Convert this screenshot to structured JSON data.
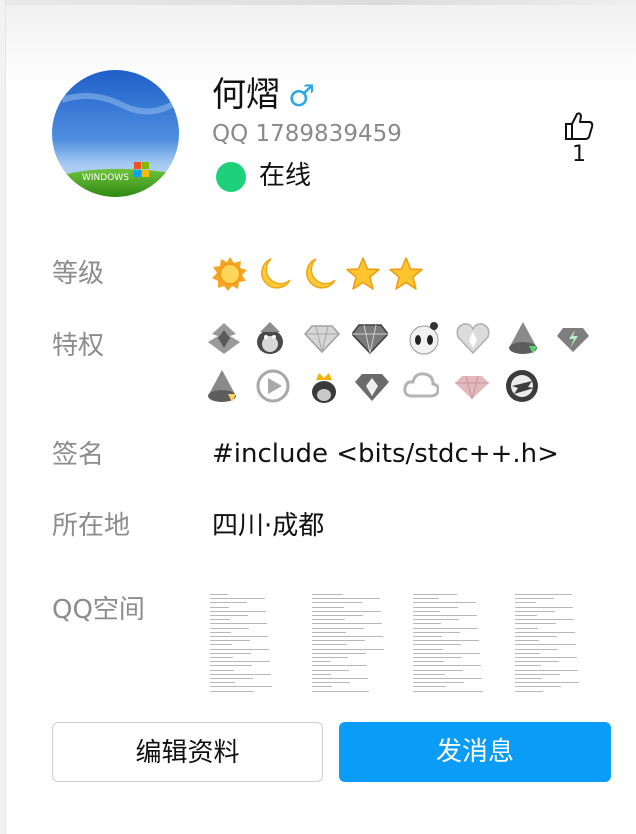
{
  "profile": {
    "name": "何熠",
    "gender_symbol": "♂",
    "qq_number": "QQ 1789839459",
    "status": "在线",
    "like_count": "1",
    "avatar_text": "WINDOWS"
  },
  "labels": {
    "level": "等级",
    "privilege": "特权",
    "signature": "签名",
    "location": "所在地",
    "qzone": "QQ空间"
  },
  "values": {
    "signature": "#include <bits/stdc++.h>",
    "location": "四川·成都"
  },
  "level_icons": [
    "sun-icon",
    "moon-icon",
    "moon-icon",
    "star-icon",
    "star-icon"
  ],
  "privilege_icons": [
    "svip-icon",
    "penguin-vip-icon",
    "diamond-icon",
    "red-diamond-icon",
    "panda-icon",
    "heart-gem-icon",
    "penguin-green-icon",
    "green-diamond-icon",
    "penguin-yellow-icon",
    "video-play-icon",
    "crown-penguin-icon",
    "dark-diamond-icon",
    "cloud-icon",
    "pink-diamond-icon",
    "cf-icon"
  ],
  "buttons": {
    "edit": "编辑资料",
    "message": "发消息"
  },
  "colors": {
    "accent": "#0a9cf6",
    "online": "#1fd07a",
    "gender": "#2ea7e6",
    "label": "#8d8d8d"
  }
}
